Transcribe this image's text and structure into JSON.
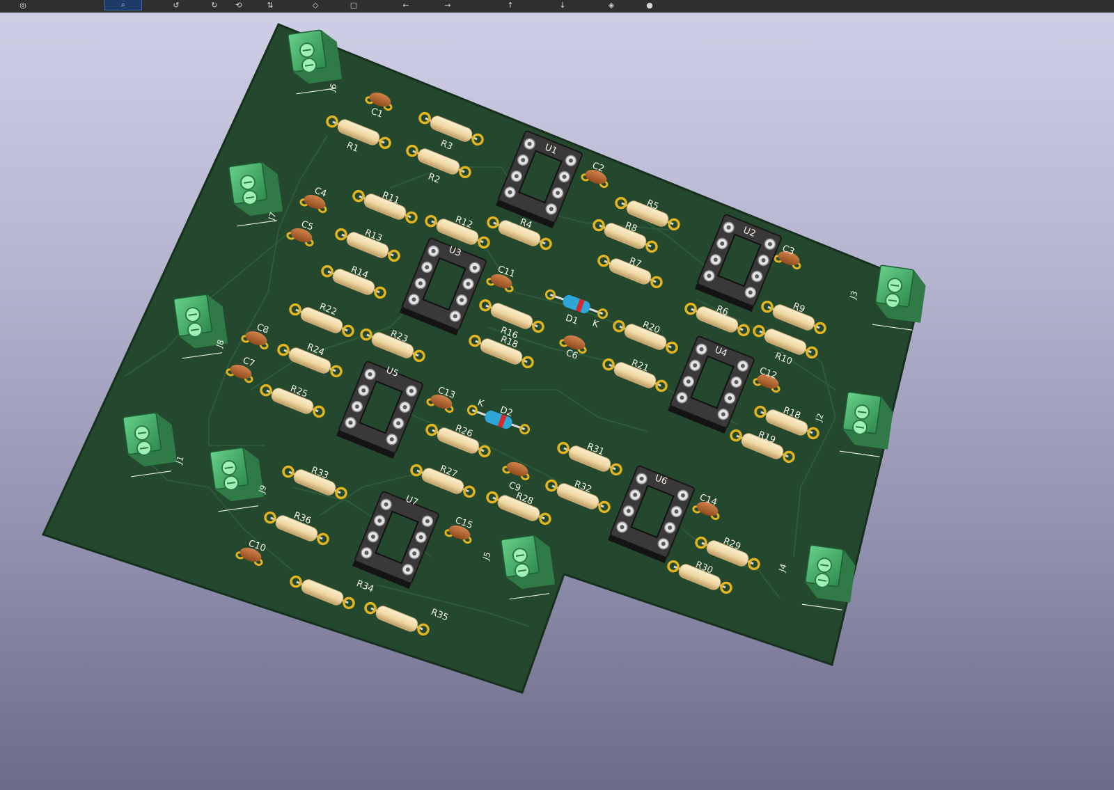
{
  "toolbar": {
    "buttons": [
      {
        "name": "view-mode-icon",
        "glyph": "◎"
      },
      {
        "name": "zoom-icon",
        "glyph": "⌕",
        "selected": true
      },
      {
        "name": "rotate-x-icon",
        "glyph": "↺"
      },
      {
        "name": "rotate-y-icon",
        "glyph": "↻"
      },
      {
        "name": "rotate-z-icon",
        "glyph": "⟲"
      },
      {
        "name": "flip-icon",
        "glyph": "⇅"
      },
      {
        "name": "perspective-icon",
        "glyph": "◇"
      },
      {
        "name": "ortho-icon",
        "glyph": "▢"
      },
      {
        "name": "move-left-icon",
        "glyph": "←"
      },
      {
        "name": "move-right-icon",
        "glyph": "→"
      },
      {
        "name": "move-up-icon",
        "glyph": "↑"
      },
      {
        "name": "move-down-icon",
        "glyph": "↓"
      },
      {
        "name": "layers-icon",
        "glyph": "◈"
      },
      {
        "name": "render-icon",
        "glyph": "●"
      }
    ]
  },
  "board": {
    "colors": {
      "pcb": "#24482e",
      "pcb_edge": "#1a3522",
      "trace": "#2d5636",
      "resistor": "#f0d9a6",
      "resistor_shade": "#c9ab74",
      "pad": "#e2b421",
      "capacitor": "#b9642c",
      "socket": "#2d2b2c",
      "socket_pin": "#cfcfcf",
      "terminal": "#48b86a",
      "terminal_face": "#8fe6a6",
      "diode_body": "#2fa6d8",
      "diode_band": "#d8282a"
    },
    "resistors": [
      "R1",
      "R2",
      "R3",
      "R4",
      "R5",
      "R6",
      "R7",
      "R8",
      "R9",
      "R10",
      "R11",
      "R12",
      "R13",
      "R14",
      "R16",
      "R18",
      "R19",
      "R20",
      "R21",
      "R22",
      "R23",
      "R24",
      "R25",
      "R26",
      "R27",
      "R28",
      "R29",
      "R30",
      "R31",
      "R32",
      "R33",
      "R34",
      "R35",
      "R36"
    ],
    "capacitors": [
      "C1",
      "C2",
      "C3",
      "C4",
      "C5",
      "C6",
      "C7",
      "C8",
      "C9",
      "C10",
      "C11",
      "C12",
      "C13",
      "C14",
      "C15"
    ],
    "ics": [
      "U1",
      "U2",
      "U3",
      "U4",
      "U5",
      "U6",
      "U7"
    ],
    "connectors": [
      "J1",
      "J2",
      "J3",
      "J4",
      "J5",
      "J6",
      "J7",
      "J8",
      "J9"
    ],
    "diodes": [
      "D1",
      "D2"
    ],
    "diode_cathode_mark": "K"
  }
}
